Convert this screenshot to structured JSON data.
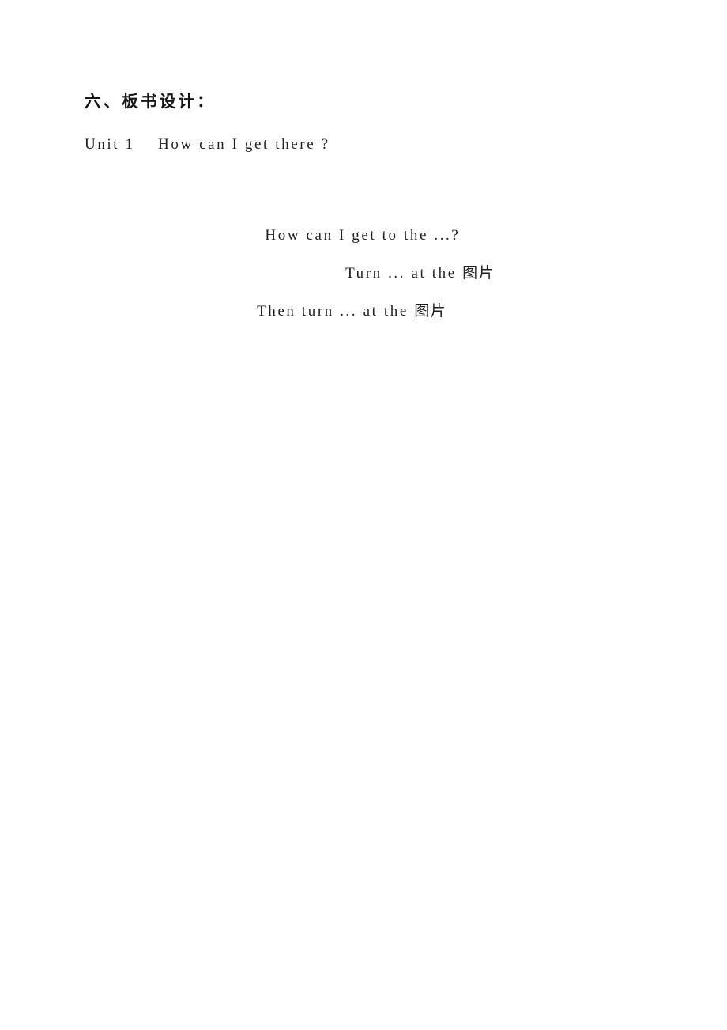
{
  "document": {
    "page_background": "#ffffff",
    "text_color": "#1f1f1f",
    "heading": {
      "text": "六、板书设计："
    },
    "unit_line": {
      "text": "Unit 1    How can I get there ?"
    },
    "blackboard_design": {
      "lines": [
        {
          "latin": "How can I get to the ...?",
          "cjk": ""
        },
        {
          "latin": "Turn ... at the ",
          "cjk": "图片"
        },
        {
          "latin": "Then turn ... at the ",
          "cjk": "图片"
        }
      ]
    }
  }
}
